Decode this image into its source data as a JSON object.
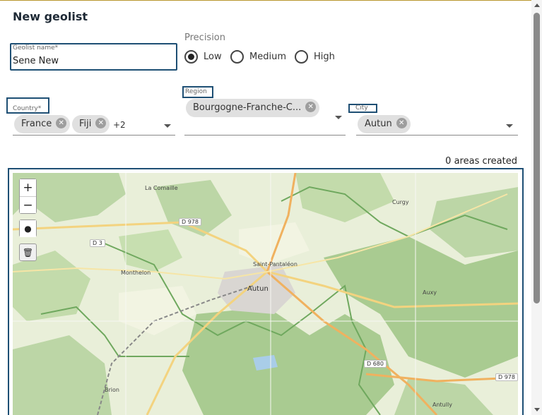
{
  "dialog": {
    "title": "New geolist"
  },
  "geolist_name": {
    "label": "Geolist name*",
    "value": "Sene New"
  },
  "precision": {
    "label": "Precision",
    "options": [
      {
        "label": "Low",
        "selected": true
      },
      {
        "label": "Medium",
        "selected": false
      },
      {
        "label": "High",
        "selected": false
      }
    ]
  },
  "country": {
    "label": "Country*",
    "chips": [
      "France",
      "Fiji"
    ],
    "more": "+2"
  },
  "region": {
    "label": "Region",
    "chips": [
      "Bourgogne-Franche-C..."
    ]
  },
  "city": {
    "label": "City",
    "chips": [
      "Autun"
    ]
  },
  "areas_created": "0 areas created",
  "map": {
    "controls": {
      "zoom_in": "+",
      "zoom_out": "−",
      "marker": "●",
      "delete": "🗑"
    },
    "places": [
      "La Comaille",
      "Curgy",
      "Monthelon",
      "Saint-Pantaléon",
      "Autun",
      "Auxy",
      "Brion",
      "Antully"
    ],
    "roads": [
      "D 978",
      "D 3",
      "D 680",
      "D 978"
    ],
    "colors": {
      "forest": "#b9d3a3",
      "farmland": "#eef0d6",
      "road": "#f4c67a",
      "border": "#7fb06b"
    }
  },
  "colors": {
    "accent": "#1e4f74"
  }
}
